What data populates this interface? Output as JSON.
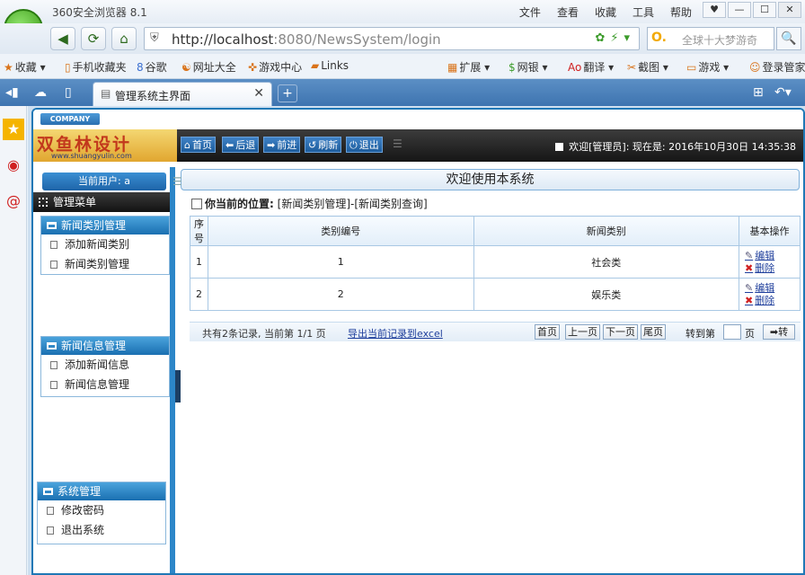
{
  "browser": {
    "title": "360安全浏览器 8.1",
    "menu": [
      "文件",
      "查看",
      "收藏",
      "工具",
      "帮助"
    ],
    "url_host": "http://localhost",
    "url_rest": ":8080/NewsSystem/login",
    "search_placeholder": "全球十大梦游奇",
    "favorites": [
      "收藏",
      "手机收藏夹",
      "谷歌",
      "网址大全",
      "游戏中心",
      "Links",
      "扩展",
      "网银",
      "翻译",
      "截图",
      "游戏",
      "登录管家"
    ],
    "tab_label": "管理系统主界面"
  },
  "header": {
    "company": "COMPANY",
    "brand_cn": "双鱼林设计",
    "brand_en": "www.shuangyulin.com",
    "buttons": [
      "首页",
      "后退",
      "前进",
      "刷新",
      "退出"
    ],
    "welcome": "欢迎[管理员]:   现在是: 2016年10月30日 14:35:38"
  },
  "leftnav": {
    "current_user": "当前用户: a",
    "menu_title": "管理菜单",
    "groups": [
      {
        "title": "新闻类别管理",
        "items": [
          "添加新闻类别",
          "新闻类别管理"
        ]
      },
      {
        "title": "新闻信息管理",
        "items": [
          "添加新闻信息",
          "新闻信息管理"
        ]
      },
      {
        "title": "系统管理",
        "items": [
          "修改密码",
          "退出系统"
        ]
      }
    ]
  },
  "main": {
    "welcome_title": "欢迎使用本系统",
    "position_label": "你当前的位置:",
    "position_value": "[新闻类别管理]-[新闻类别查询]",
    "table": {
      "headers": [
        "序号",
        "类别编号",
        "新闻类别",
        "基本操作"
      ],
      "rows": [
        {
          "seq": "1",
          "id": "1",
          "name": "社会类"
        },
        {
          "seq": "2",
          "id": "2",
          "name": "娱乐类"
        }
      ],
      "edit_label": "编辑",
      "delete_label": "删除"
    },
    "pager": {
      "info": "共有2条记录, 当前第 1/1 页",
      "export": "导出当前记录到excel",
      "first": "首页",
      "prev": "上一页",
      "next": "下一页",
      "last": "尾页",
      "goto": "转到第",
      "page_unit": "页",
      "go": "转"
    }
  }
}
